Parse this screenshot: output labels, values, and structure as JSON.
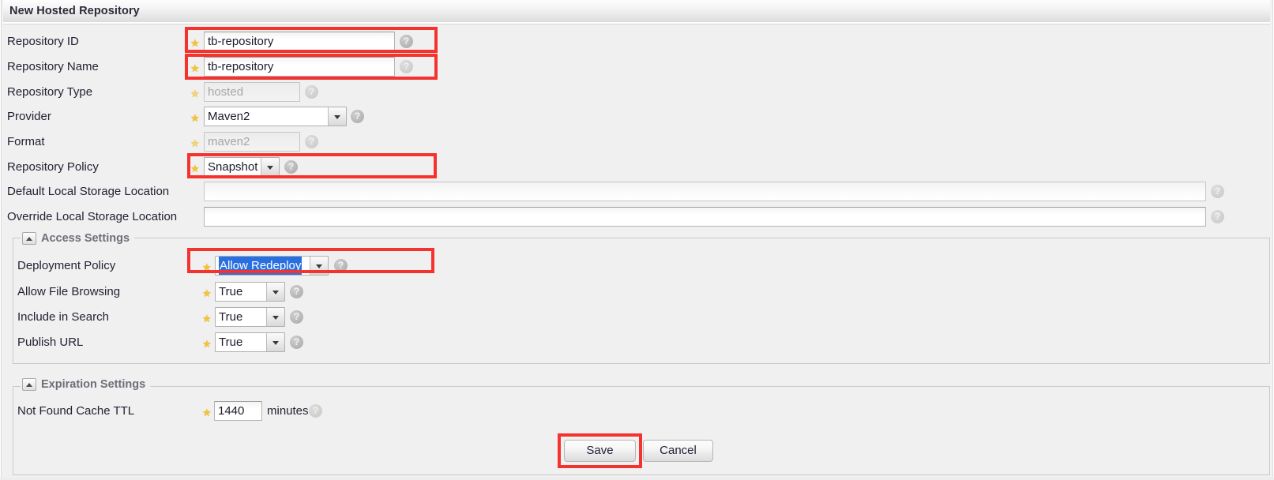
{
  "window": {
    "title": "New Hosted Repository"
  },
  "form": {
    "fields": [
      {
        "label": "Repository ID",
        "value": "tb-repository",
        "control": "text",
        "required": true,
        "readonly": false,
        "highlighted": true
      },
      {
        "label": "Repository Name",
        "value": "tb-repository",
        "control": "text",
        "required": true,
        "readonly": false,
        "highlighted": true
      },
      {
        "label": "Repository Type",
        "value": "hosted",
        "control": "text",
        "required": true,
        "readonly": true,
        "highlighted": false
      },
      {
        "label": "Provider",
        "value": "Maven2",
        "control": "select",
        "required": true,
        "readonly": false,
        "highlighted": false
      },
      {
        "label": "Format",
        "value": "maven2",
        "control": "text",
        "required": true,
        "readonly": true,
        "highlighted": false
      },
      {
        "label": "Repository Policy",
        "value": "Snapshot",
        "control": "select",
        "required": true,
        "readonly": false,
        "highlighted": true
      },
      {
        "label": "Default Local Storage Location",
        "value": "",
        "control": "text",
        "required": false,
        "readonly": true,
        "highlighted": false
      },
      {
        "label": "Override Local Storage Location",
        "value": "",
        "control": "text",
        "required": false,
        "readonly": false,
        "highlighted": false
      }
    ]
  },
  "access_settings": {
    "legend": "Access Settings",
    "collapse_icon": "triangle-up-icon",
    "fields": [
      {
        "label": "Deployment Policy",
        "value": "Allow Redeploy",
        "control": "select",
        "required": true,
        "selected_text": true,
        "highlighted": true
      },
      {
        "label": "Allow File Browsing",
        "value": "True",
        "control": "select",
        "required": true,
        "selected_text": false,
        "highlighted": false
      },
      {
        "label": "Include in Search",
        "value": "True",
        "control": "select",
        "required": true,
        "selected_text": false,
        "highlighted": false
      },
      {
        "label": "Publish URL",
        "value": "True",
        "control": "select",
        "required": true,
        "selected_text": false,
        "highlighted": false
      }
    ]
  },
  "expiration_settings": {
    "legend": "Expiration Settings",
    "collapse_icon": "triangle-up-icon",
    "ttl": {
      "label": "Not Found Cache TTL",
      "value": "1440",
      "unit": "minutes",
      "required": true
    }
  },
  "actions": {
    "save_label": "Save",
    "cancel_label": "Cancel",
    "save_highlighted": true
  },
  "icons": {
    "help": "?",
    "required_star": "★"
  },
  "colors": {
    "annotation": "#f5332e",
    "required_star": "#f5c434",
    "selection": "#2a6fe0",
    "page_bg": "#f0f0f0",
    "titlebar_bg": "#e9e9e9"
  }
}
